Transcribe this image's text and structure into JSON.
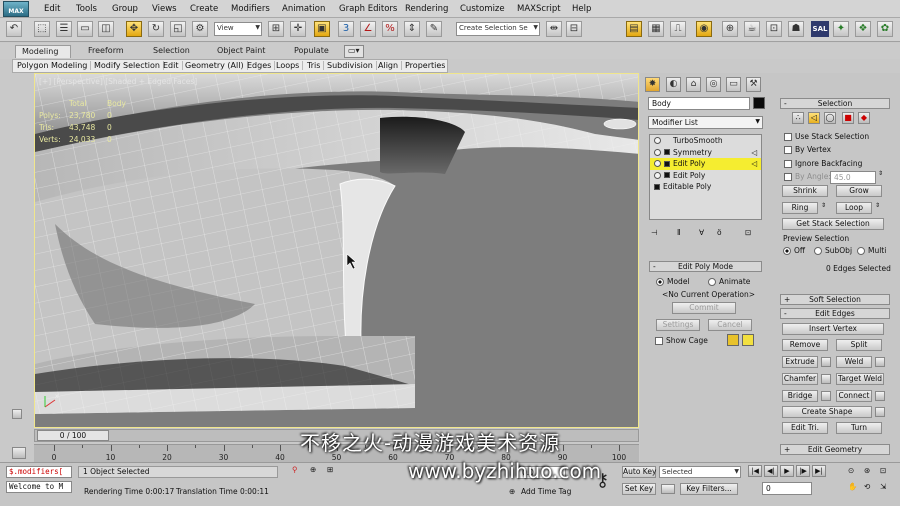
{
  "menubar": {
    "logo": "MAX",
    "items": [
      "Edit",
      "Tools",
      "Group",
      "Views",
      "Create",
      "Modifiers",
      "Animation",
      "Graph Editors",
      "Rendering",
      "Customize",
      "MAXScript",
      "Help"
    ]
  },
  "toolbar": {
    "filter_value": "All",
    "ref_coord_value": "View",
    "selection_set_placeholder": "Create Selection Se"
  },
  "ribbon": {
    "tabs": [
      "Modeling",
      "Freeform",
      "Selection",
      "Object Paint",
      "Populate"
    ],
    "active_tab": "Modeling",
    "subtabs": [
      "Polygon Modeling",
      "Modify Selection",
      "Edit",
      "Geometry (All)",
      "Edges",
      "Loops",
      "Tris",
      "Subdivision",
      "Align",
      "Properties"
    ]
  },
  "viewport": {
    "label": "[+] [Perspective] [Shaded + Edged Faces]",
    "stats_header": [
      "Total",
      "Body"
    ],
    "stats": [
      {
        "label": "Polys:",
        "total": "23,780",
        "body": "0"
      },
      {
        "label": "Tris:",
        "total": "43,748",
        "body": "0"
      },
      {
        "label": "Verts:",
        "total": "24,033",
        "body": "0"
      }
    ],
    "border_color": "#f0e68c",
    "background_color": "#7d7d7d"
  },
  "command_panel": {
    "object_name": "Body",
    "object_color": "#0a0a0a",
    "modifier_list_label": "Modifier List",
    "stack": [
      {
        "label": "TurboSmooth",
        "icon": "bulb-icon",
        "selected": false
      },
      {
        "label": "Symmetry",
        "icon": "box-icon",
        "selected": false
      },
      {
        "label": "Edit Poly",
        "icon": "bulb-icon",
        "selected": true
      },
      {
        "label": "Edit Poly",
        "icon": "bulb-icon",
        "selected": false
      },
      {
        "label": "Editable Poly",
        "icon": "box-icon",
        "selected": false
      }
    ],
    "edit_poly_mode": {
      "title": "Edit Poly Mode",
      "model": "Model",
      "animate": "Animate",
      "current_op": "<No Current Operation>",
      "commit": "Commit",
      "settings": "Settings",
      "cancel": "Cancel",
      "show_cage": "Show Cage",
      "cage_colors": [
        "#e8c22b",
        "#f2e040"
      ]
    },
    "selection": {
      "title": "Selection",
      "use_stack": "Use Stack Selection",
      "by_vertex": "By Vertex",
      "ignore_backfacing": "Ignore Backfacing",
      "by_angle": "By Angle:",
      "by_angle_value": "45.0",
      "shrink": "Shrink",
      "grow": "Grow",
      "ring": "Ring",
      "loop": "Loop",
      "get_stack": "Get Stack Selection",
      "preview": "Preview Selection",
      "preview_off": "Off",
      "preview_subobj": "SubObj",
      "preview_multi": "Multi",
      "status": "0 Edges Selected"
    },
    "soft_selection": "Soft Selection",
    "edit_edges": {
      "title": "Edit Edges",
      "insert_vertex": "Insert Vertex",
      "remove": "Remove",
      "split": "Split",
      "extrude": "Extrude",
      "weld": "Weld",
      "chamfer": "Chamfer",
      "target_weld": "Target Weld",
      "bridge": "Bridge",
      "connect": "Connect",
      "create_shape": "Create Shape",
      "edit_tri": "Edit Tri.",
      "turn": "Turn"
    },
    "edit_geometry": "Edit Geometry"
  },
  "timeline": {
    "frame": "0 / 100",
    "ticks": [
      "0",
      "10",
      "20",
      "30",
      "40",
      "50",
      "60",
      "70",
      "80",
      "90",
      "100"
    ]
  },
  "status": {
    "maxscript_1": "$.modifiers[",
    "maxscript_2": "Welcome to M",
    "selected": "1 Object Selected",
    "render_time": "Rendering Time  0:00:17",
    "translation_time": "Translation Time  0:00:11",
    "add_time_tag": "Add Time Tag",
    "auto_key": "Auto Key",
    "set_key": "Set Key",
    "selected_dd": "Selected",
    "key_filters": "Key Filters...",
    "frame_value": "0",
    "coord_value": "0.0"
  },
  "watermark": {
    "line1": "不移之火-动漫游戏美术资源",
    "line2": "www.byzhihuo.com"
  }
}
